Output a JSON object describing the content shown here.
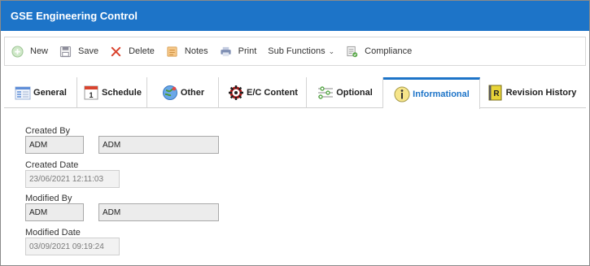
{
  "window": {
    "title": "GSE Engineering Control"
  },
  "toolbar": {
    "new_label": "New",
    "save_label": "Save",
    "delete_label": "Delete",
    "notes_label": "Notes",
    "print_label": "Print",
    "sub_functions_label": "Sub Functions",
    "compliance_label": "Compliance"
  },
  "tabs": [
    {
      "label": "General",
      "icon": "general-icon"
    },
    {
      "label": "Schedule",
      "icon": "calendar-icon"
    },
    {
      "label": "Other",
      "icon": "globe-icon"
    },
    {
      "label": "E/C Content",
      "icon": "gear-icon"
    },
    {
      "label": "Optional",
      "icon": "sliders-icon"
    },
    {
      "label": "Informational",
      "icon": "info-icon",
      "active": true
    },
    {
      "label": "Revision History",
      "icon": "revision-book-icon"
    }
  ],
  "schedule_icon_text": "1",
  "revision_icon_text": "R",
  "informational": {
    "created_by_label": "Created By",
    "created_by_code": "ADM",
    "created_by_name": "ADM",
    "created_date_label": "Created Date",
    "created_date": "23/06/2021 12:11:03",
    "modified_by_label": "Modified By",
    "modified_by_code": "ADM",
    "modified_by_name": "ADM",
    "modified_date_label": "Modified Date",
    "modified_date": "03/09/2021 09:19:24"
  },
  "colors": {
    "accent": "#1d74c8",
    "titlebar": "#1d74c8"
  }
}
